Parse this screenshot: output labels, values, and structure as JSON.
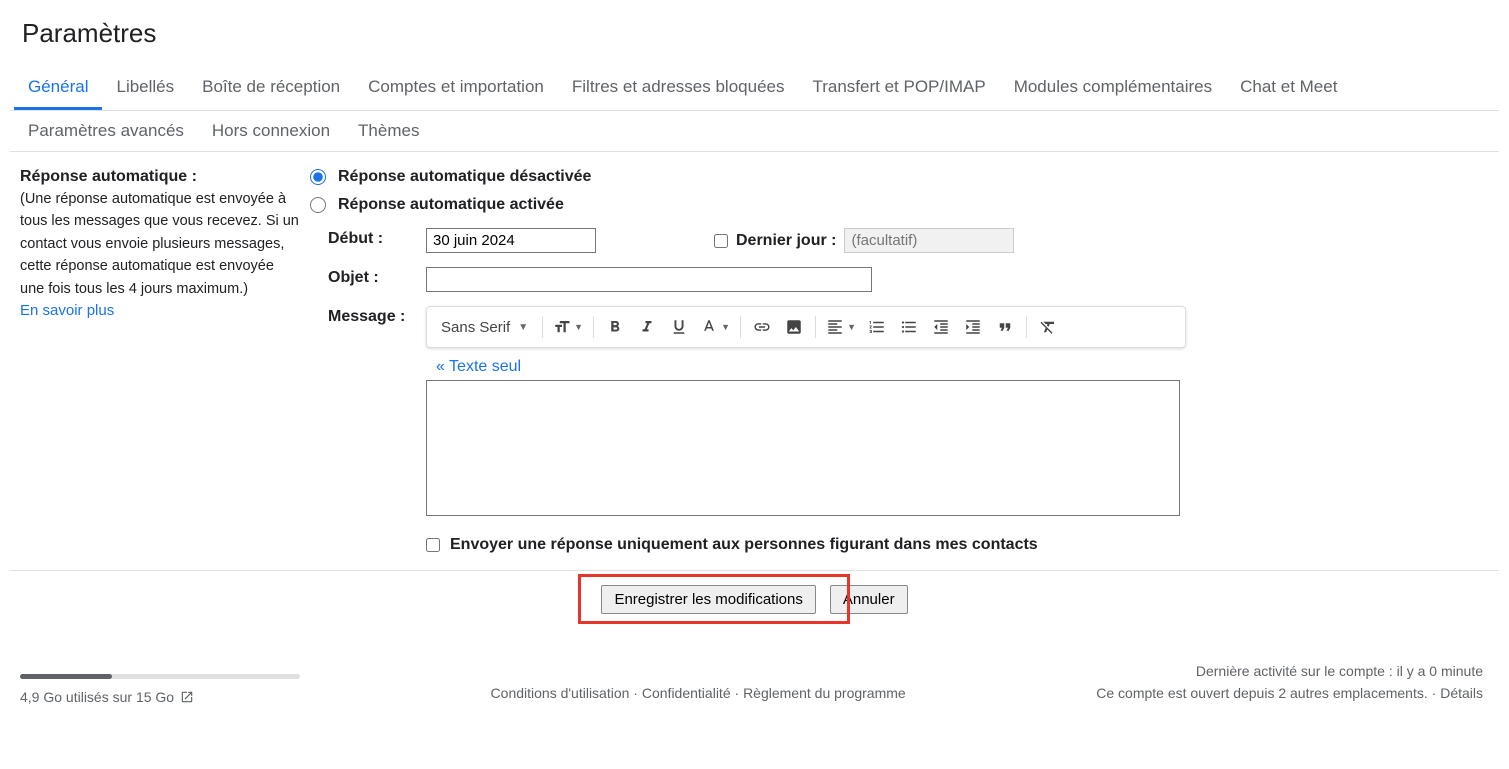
{
  "page_title": "Paramètres",
  "tabs_row1": [
    {
      "id": "general",
      "label": "Général",
      "active": true
    },
    {
      "id": "labels",
      "label": "Libellés"
    },
    {
      "id": "inbox",
      "label": "Boîte de réception"
    },
    {
      "id": "accounts",
      "label": "Comptes et importation"
    },
    {
      "id": "filters",
      "label": "Filtres et adresses bloquées"
    },
    {
      "id": "forwarding",
      "label": "Transfert et POP/IMAP"
    },
    {
      "id": "addons",
      "label": "Modules complémentaires"
    },
    {
      "id": "chat",
      "label": "Chat et Meet"
    }
  ],
  "tabs_row2": [
    {
      "id": "advanced",
      "label": "Paramètres avancés"
    },
    {
      "id": "offline",
      "label": "Hors connexion"
    },
    {
      "id": "themes",
      "label": "Thèmes"
    }
  ],
  "vacation": {
    "section_label": "Réponse automatique :",
    "section_desc": "(Une réponse automatique est envoyée à tous les messages que vous recevez. Si un contact vous envoie plusieurs messages, cette réponse automatique est envoyée une fois tous les 4 jours maximum.)",
    "learn_more": "En savoir plus",
    "radio_off": "Réponse automatique désactivée",
    "radio_on": "Réponse automatique activée",
    "start_label": "Début :",
    "start_value": "30 juin 2024",
    "end_label": "Dernier jour :",
    "end_placeholder": "(facultatif)",
    "subject_label": "Objet :",
    "subject_value": "",
    "message_label": "Message :",
    "font_name": "Sans Serif",
    "plain_text_link": "« Texte seul",
    "contacts_only": "Envoyer une réponse uniquement aux personnes figurant dans mes contacts"
  },
  "buttons": {
    "save": "Enregistrer les modifications",
    "cancel": "Annuler"
  },
  "footer": {
    "storage": "4,9 Go utilisés sur 15 Go",
    "terms": "Conditions d'utilisation",
    "privacy": "Confidentialité",
    "program": "Règlement du programme",
    "sep": " · ",
    "activity_line1": "Dernière activité sur le compte : il y a 0 minute",
    "activity_line2_pre": "Ce compte est ouvert depuis 2 autres emplacements. · ",
    "details": "Détails"
  }
}
